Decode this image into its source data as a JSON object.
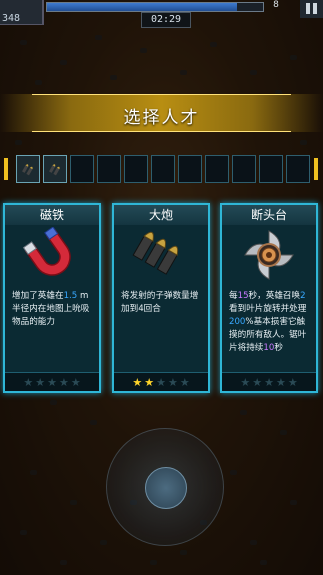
{
  "hud": {
    "score": "348",
    "timer": "02:29",
    "hp_fraction": 0.88,
    "top_right": "8"
  },
  "banner": {
    "title": "选择人才"
  },
  "slots": {
    "total": 11,
    "filled": 2,
    "icons": [
      "bullets-icon",
      "bullets-icon"
    ]
  },
  "cards": [
    {
      "title": "磁铁",
      "icon": "magnet-icon",
      "desc_parts": [
        {
          "t": "增加了英雄在"
        },
        {
          "t": "1.5",
          "c": "hl"
        },
        {
          "t": " m半径内在地图上吮吸物品的能力"
        }
      ],
      "stars_on": 0,
      "stars_total": 5
    },
    {
      "title": "大炮",
      "icon": "cannon-shells-icon",
      "desc_parts": [
        {
          "t": "将发射的子弹数量增加到4回合"
        }
      ],
      "stars_on": 2,
      "stars_total": 5
    },
    {
      "title": "断头台",
      "icon": "spinning-blade-icon",
      "desc_parts": [
        {
          "t": "每"
        },
        {
          "t": "15",
          "c": "hl-pur"
        },
        {
          "t": "秒，英雄召唤"
        },
        {
          "t": "2",
          "c": "hl"
        },
        {
          "t": "看到叶片旋转并处理"
        },
        {
          "t": "200",
          "c": "hl"
        },
        {
          "t": "%基本损害它触摸的所有敌人。锯叶片将持续"
        },
        {
          "t": "10",
          "c": "hl-pur"
        },
        {
          "t": "秒"
        }
      ],
      "stars_on": 0,
      "stars_total": 5
    }
  ],
  "colors": {
    "accent": "#2fb6d6",
    "star_on": "#ffd52a",
    "gold": "#f0c020"
  }
}
